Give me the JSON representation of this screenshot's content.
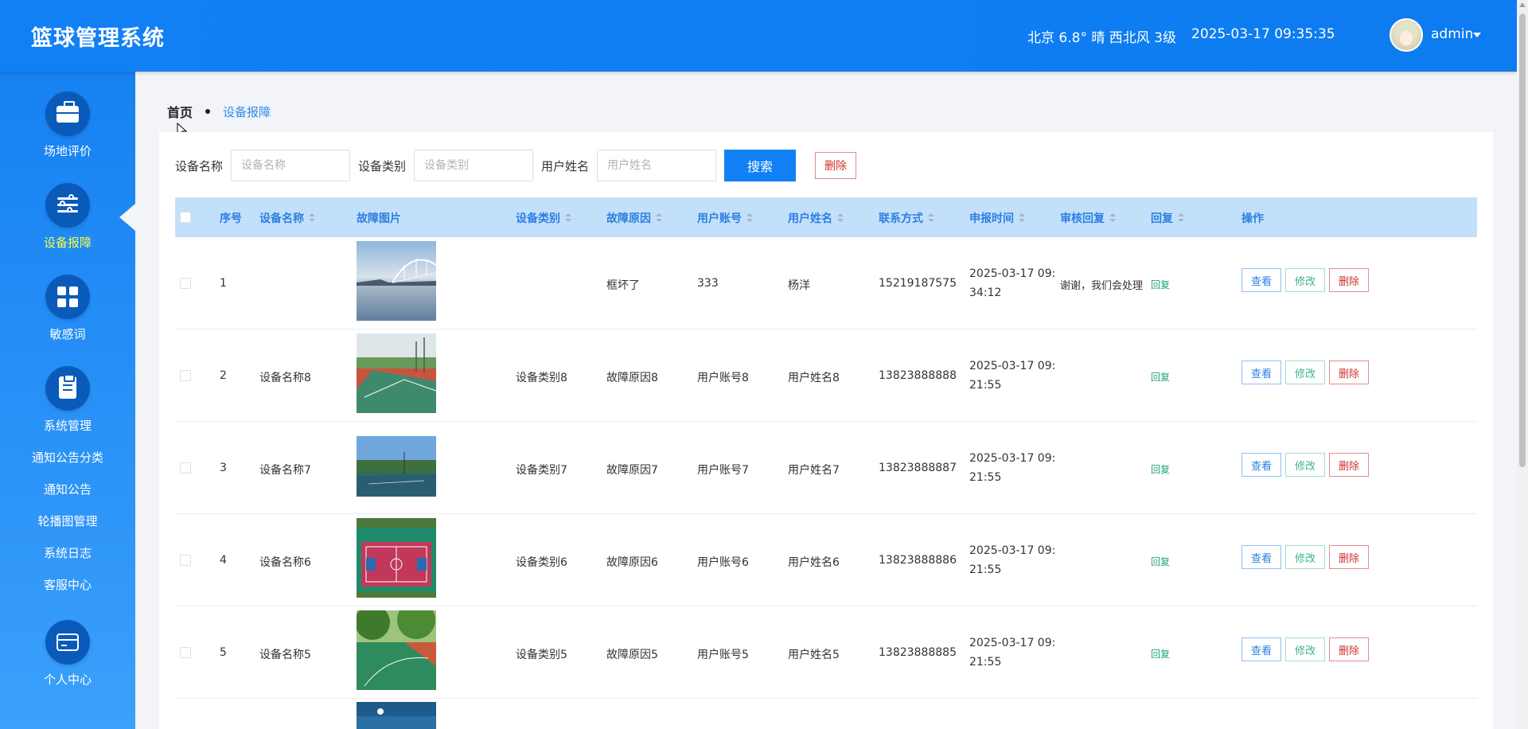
{
  "header": {
    "title": "篮球管理系统",
    "weather": "北京 6.8° 晴 西北风 3级",
    "datetime": "2025-03-17 09:35:35",
    "username": "admin"
  },
  "sidebar": {
    "items": [
      {
        "label": "场地评价",
        "icon": "briefcase-icon"
      },
      {
        "label": "设备报障",
        "icon": "sliders-icon",
        "active": true
      },
      {
        "label": "敏感词",
        "icon": "grid-icon"
      },
      {
        "label": "系统管理",
        "icon": "clipboard-icon"
      },
      {
        "label": "个人中心",
        "icon": "wallet-icon"
      }
    ],
    "sub_items": [
      "通知公告分类",
      "通知公告",
      "轮播图管理",
      "系统日志",
      "客服中心"
    ]
  },
  "breadcrumb": {
    "home": "首页",
    "current": "设备报障"
  },
  "search": {
    "device_name_label": "设备名称",
    "device_name_placeholder": "设备名称",
    "device_type_label": "设备类别",
    "device_type_placeholder": "设备类别",
    "user_name_label": "用户姓名",
    "user_name_placeholder": "用户姓名",
    "search_button": "搜索",
    "delete_button": "删除"
  },
  "table": {
    "columns": [
      "序号",
      "设备名称",
      "故障图片",
      "设备类别",
      "故障原因",
      "用户账号",
      "用户姓名",
      "联系方式",
      "申报时间",
      "审核回复",
      "回复",
      "操作"
    ],
    "actions": {
      "view": "查看",
      "edit": "修改",
      "delete": "删除",
      "reply": "回复"
    },
    "rows": [
      {
        "index": "1",
        "device_name": "",
        "device_type": "",
        "reason": "框坏了",
        "account": "333",
        "user_name": "杨洋",
        "phone": "15219187575",
        "time_line1": "2025-03-17 09:",
        "time_line2": "34:12",
        "review_reply": "谢谢，我们会处理"
      },
      {
        "index": "2",
        "device_name": "设备名称8",
        "device_type": "设备类别8",
        "reason": "故障原因8",
        "account": "用户账号8",
        "user_name": "用户姓名8",
        "phone": "13823888888",
        "time_line1": "2025-03-17 09:",
        "time_line2": "21:55",
        "review_reply": ""
      },
      {
        "index": "3",
        "device_name": "设备名称7",
        "device_type": "设备类别7",
        "reason": "故障原因7",
        "account": "用户账号7",
        "user_name": "用户姓名7",
        "phone": "13823888887",
        "time_line1": "2025-03-17 09:",
        "time_line2": "21:55",
        "review_reply": ""
      },
      {
        "index": "4",
        "device_name": "设备名称6",
        "device_type": "设备类别6",
        "reason": "故障原因6",
        "account": "用户账号6",
        "user_name": "用户姓名6",
        "phone": "13823888886",
        "time_line1": "2025-03-17 09:",
        "time_line2": "21:55",
        "review_reply": ""
      },
      {
        "index": "5",
        "device_name": "设备名称5",
        "device_type": "设备类别5",
        "reason": "故障原因5",
        "account": "用户账号5",
        "user_name": "用户姓名5",
        "phone": "13823888885",
        "time_line1": "2025-03-17 09:",
        "time_line2": "21:55",
        "review_reply": ""
      }
    ]
  },
  "colors": {
    "header": "#1180f4",
    "sidebar_top": "#1681f2",
    "sidebar_bottom": "#3aa0fb",
    "active_text": "#f6ff45",
    "table_head": "#c3e0fb"
  }
}
